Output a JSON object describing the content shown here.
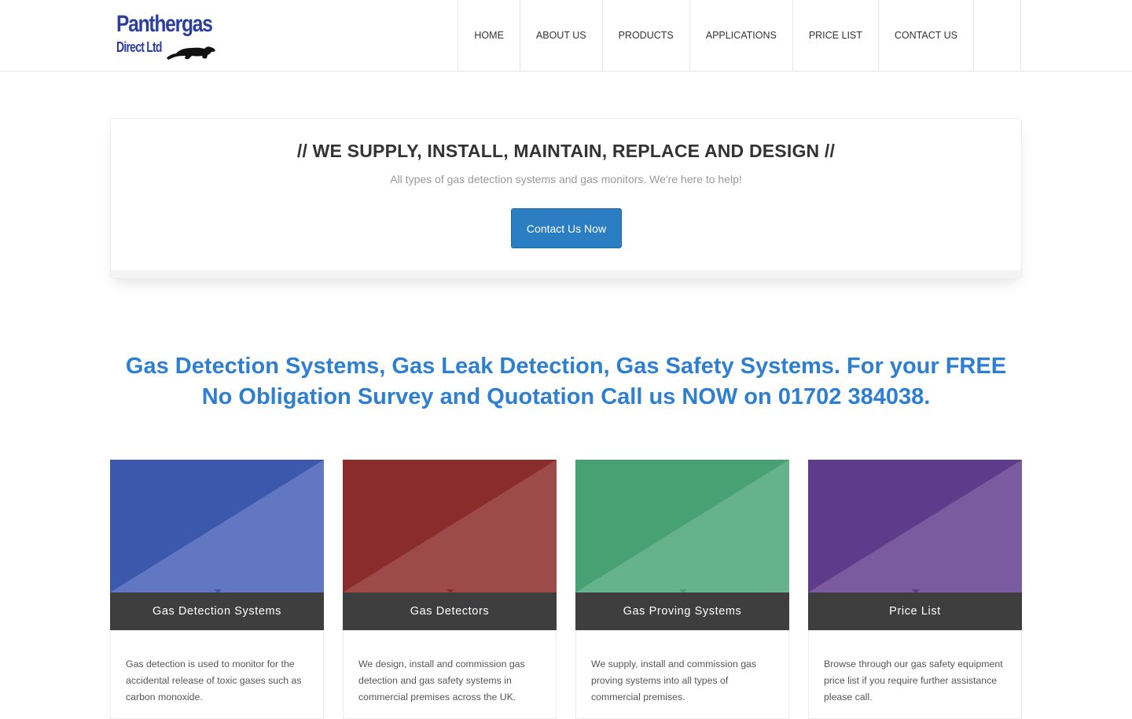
{
  "header": {
    "logo": {
      "line1": "Panthergas",
      "line2": "Direct Ltd"
    },
    "nav": [
      {
        "label": "HOME"
      },
      {
        "label": "ABOUT US"
      },
      {
        "label": "PRODUCTS"
      },
      {
        "label": "APPLICATIONS"
      },
      {
        "label": "PRICE LIST"
      },
      {
        "label": "CONTACT US"
      }
    ]
  },
  "hero": {
    "title": "// WE SUPPLY, INSTALL, MAINTAIN, REPLACE AND DESIGN //",
    "subtitle": "All types of gas detection systems and gas monitors. We're here to help!",
    "button_label": "Contact Us Now"
  },
  "tagline": "Gas Detection Systems, Gas Leak Detection, Gas Safety Systems. For your FREE No Obligation Survey and Quotation Call us NOW on 01702 384038.",
  "cards": [
    {
      "title": "Gas Detection Systems",
      "text": "Gas detection is used to monitor for the accidental release of toxic gases such as carbon monoxide.",
      "color": "#3c58ad",
      "color_light": "#6177c1"
    },
    {
      "title": "Gas Detectors",
      "text": "We design, install and commission gas detection and gas safety systems in commercial premises across the UK.",
      "color": "#8a2c2c",
      "color_light": "#9d4a4a"
    },
    {
      "title": "Gas Proving Systems",
      "text": "We supply, install and commission gas proving systems into all types of commercial premises.",
      "color": "#47a173",
      "color_light": "#66b38b"
    },
    {
      "title": "Price List",
      "text": "Browse through our gas safety equipment price list if you require further assistance please call.",
      "color": "#5e3b8b",
      "color_light": "#7b5b9f"
    }
  ]
}
